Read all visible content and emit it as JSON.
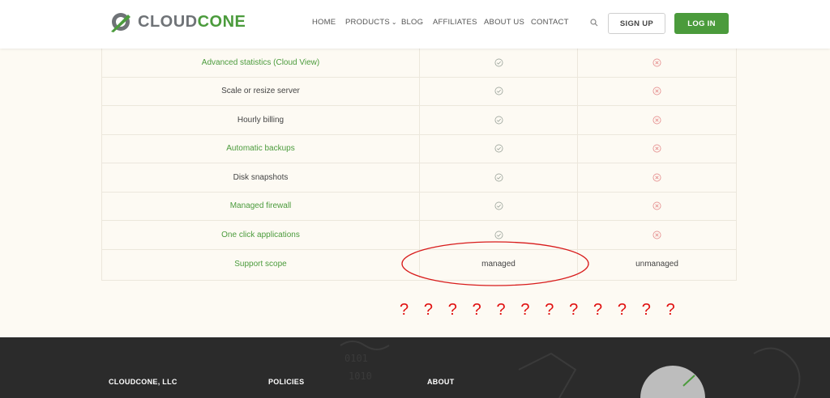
{
  "header": {
    "logo_part1": "CLOUD",
    "logo_part2": "CONE",
    "nav": [
      "HOME",
      "PRODUCTS",
      "BLOG",
      "AFFILIATES",
      "ABOUT US",
      "CONTACT"
    ],
    "signup_label": "SIGN UP",
    "login_label": "LOG IN"
  },
  "table": {
    "rows": [
      {
        "feature": "Advanced statistics (Cloud View)",
        "col_a": "check",
        "col_b": "cross"
      },
      {
        "feature": "Scale or resize server",
        "col_a": "check",
        "col_b": "cross"
      },
      {
        "feature": "Hourly billing",
        "col_a": "check",
        "col_b": "cross"
      },
      {
        "feature": "Automatic backups",
        "col_a": "check",
        "col_b": "cross"
      },
      {
        "feature": "Disk snapshots",
        "col_a": "check",
        "col_b": "cross"
      },
      {
        "feature": "Managed firewall",
        "col_a": "check",
        "col_b": "cross"
      },
      {
        "feature": "One click applications",
        "col_a": "check",
        "col_b": "cross"
      },
      {
        "feature": "Support scope",
        "col_a": "managed",
        "col_b": "unmanaged"
      }
    ]
  },
  "annotation": {
    "question_marks": "? ? ? ? ? ? ? ? ? ? ? ?",
    "color": "#e01010"
  },
  "footer": {
    "col1": "CLOUDCONE, LLC",
    "col2": "POLICIES",
    "col3": "ABOUT"
  },
  "colors": {
    "brand_green": "#4b9b3c",
    "check_gray": "#9aa39a",
    "cross_red": "#e48a8a",
    "footer_bg": "#2b2b2b"
  }
}
